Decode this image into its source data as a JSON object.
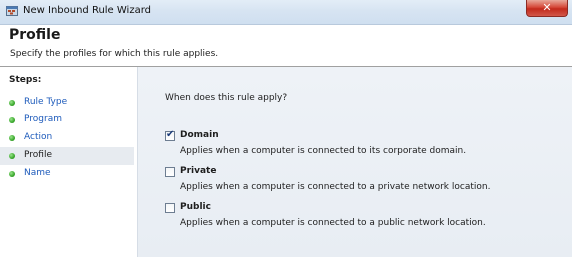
{
  "window": {
    "title": "New Inbound Rule Wizard",
    "close_glyph": "✕"
  },
  "header": {
    "title": "Profile",
    "subtitle": "Specify the profiles for which this rule applies."
  },
  "steps": {
    "label": "Steps:",
    "items": [
      {
        "label": "Rule Type",
        "current": false
      },
      {
        "label": "Program",
        "current": false
      },
      {
        "label": "Action",
        "current": false
      },
      {
        "label": "Profile",
        "current": true
      },
      {
        "label": "Name",
        "current": false
      }
    ]
  },
  "content": {
    "question": "When does this rule apply?",
    "options": [
      {
        "label": "Domain",
        "checked": true,
        "description": "Applies when a computer is connected to its corporate domain."
      },
      {
        "label": "Private",
        "checked": false,
        "description": "Applies when a computer is connected to a private network location."
      },
      {
        "label": "Public",
        "checked": false,
        "description": "Applies when a computer is connected to a public network location."
      }
    ]
  },
  "colors": {
    "step_link": "#1e5bbb",
    "step_dot": "#3aa82c",
    "content_bg": "#eef2f7"
  },
  "icons": {
    "app": "firewall-wizard-icon",
    "close": "close-icon",
    "check": "checkmark-icon"
  }
}
